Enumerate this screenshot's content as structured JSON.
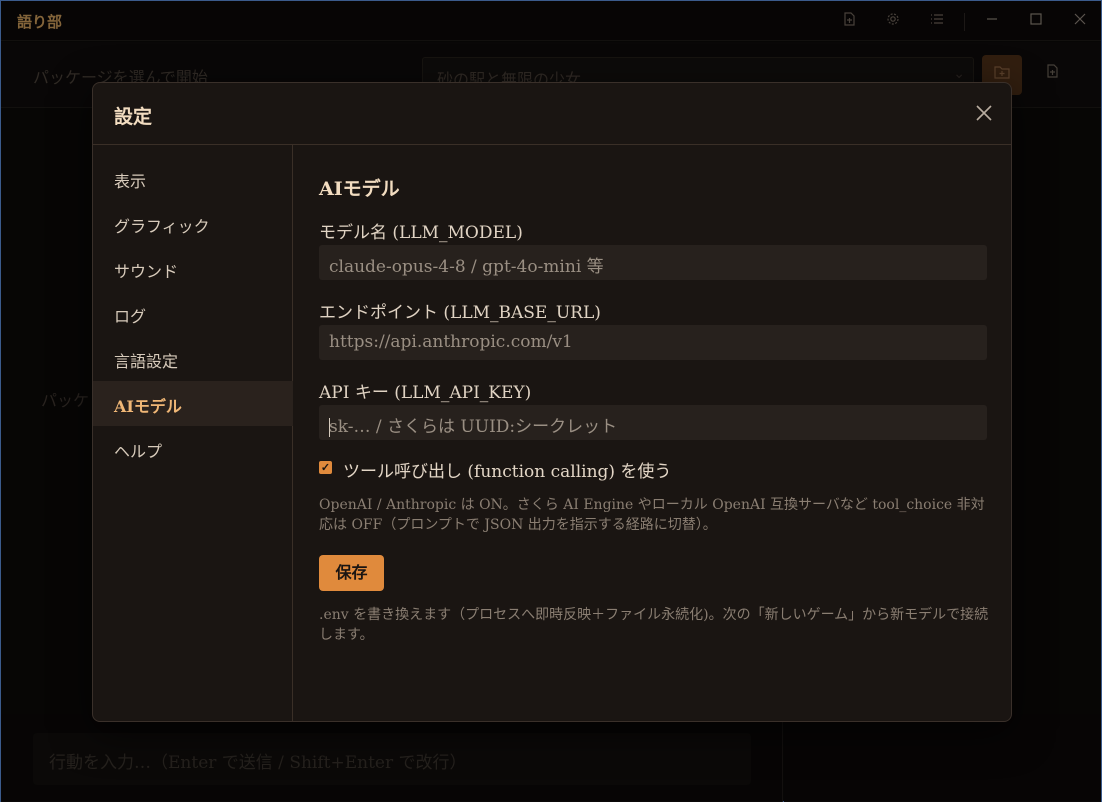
{
  "app": {
    "title": "語り部"
  },
  "titlebar_icons": [
    "export-icon",
    "gear-icon",
    "list-icon",
    "minimize-icon",
    "maximize-icon",
    "close-icon"
  ],
  "toolbar": {
    "package_label": "パッケージを選んで開始",
    "package_selected": "砂の駅と無限の少女"
  },
  "background": {
    "package_hint": "パッケ",
    "action_placeholder": "行動を入力…（Enter で送信 / Shift+Enter で改行）"
  },
  "modal": {
    "title": "設定",
    "sidebar": [
      {
        "label": "表示"
      },
      {
        "label": "グラフィック"
      },
      {
        "label": "サウンド"
      },
      {
        "label": "ログ"
      },
      {
        "label": "言語設定"
      },
      {
        "label": "AIモデル",
        "active": true
      },
      {
        "label": "ヘルプ"
      }
    ],
    "section_title": "AIモデル",
    "fields": {
      "model": {
        "label": "モデル名 (LLM_MODEL)",
        "placeholder": "claude-opus-4-8 / gpt-4o-mini 等"
      },
      "endpoint": {
        "label": "エンドポイント (LLM_BASE_URL)",
        "placeholder": "https://api.anthropic.com/v1"
      },
      "api_key": {
        "label": "API キー (LLM_API_KEY)",
        "placeholder": "sk-… / さくらは UUID:シークレット"
      }
    },
    "tool_calling": {
      "label": "ツール呼び出し (function calling) を使う",
      "checked": true,
      "help": "OpenAI / Anthropic は ON。さくら AI Engine やローカル OpenAI 互換サーバなど tool_choice 非対応は OFF（プロンプトで JSON 出力を指示する経路に切替）。"
    },
    "save_label": "保存",
    "save_note": ".env を書き換えます（プロセスへ即時反映＋ファイル永続化)。次の「新しいゲーム」から新モデルで接続します。"
  },
  "colors": {
    "accent": "#e08a3c",
    "panel": "#1a1512",
    "input": "#27211d"
  }
}
